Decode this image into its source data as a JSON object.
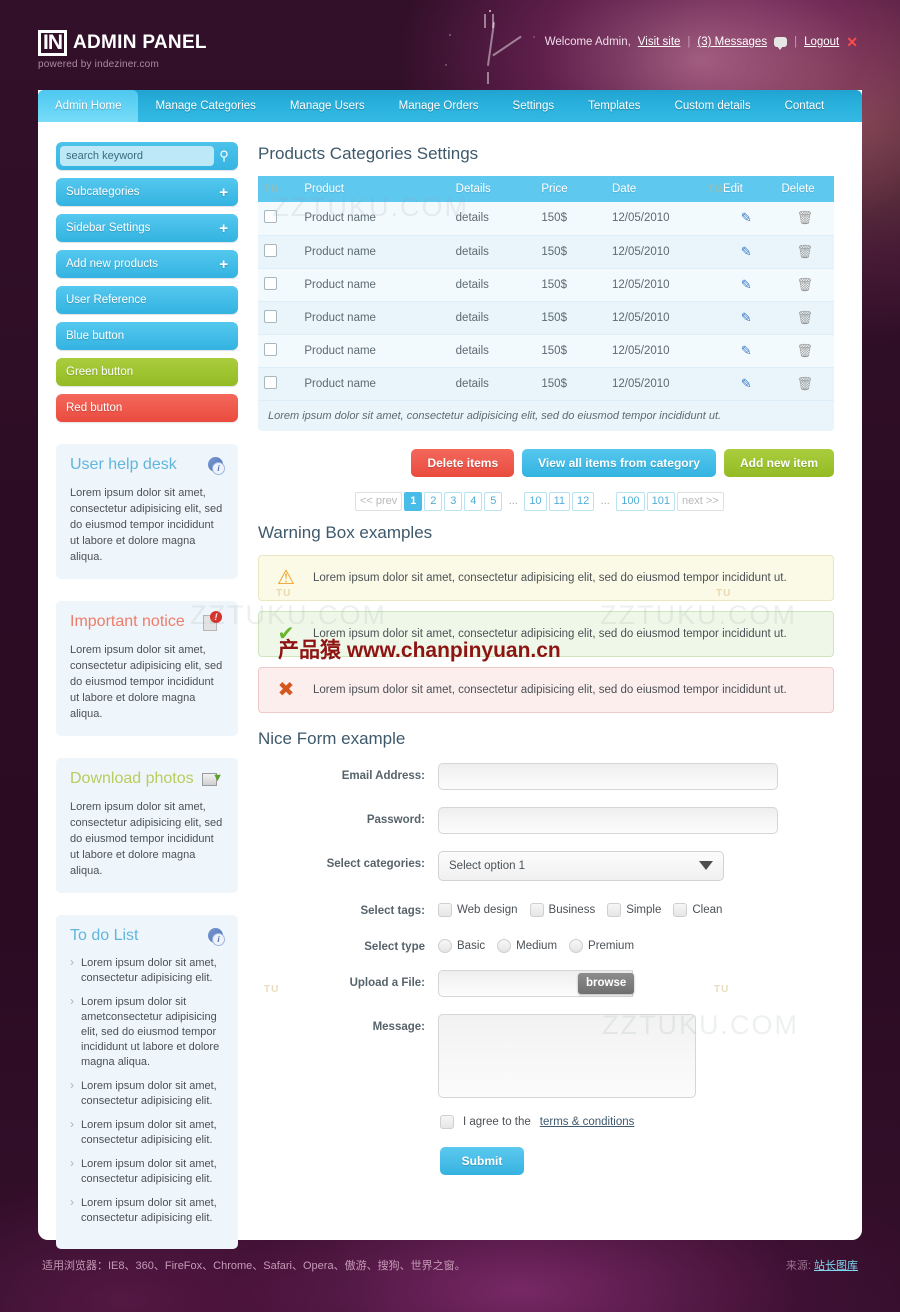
{
  "header": {
    "logo_mark": "IN",
    "logo_text": "ADMIN PANEL",
    "logo_sub": "powered by indeziner.com",
    "welcome": "Welcome Admin,",
    "visit_site": "Visit site",
    "messages": "(3) Messages",
    "logout": "Logout",
    "sep": "|"
  },
  "nav": {
    "items": [
      {
        "label": "Admin Home",
        "active": true
      },
      {
        "label": "Manage Categories",
        "active": false
      },
      {
        "label": "Manage Users",
        "active": false
      },
      {
        "label": "Manage Orders",
        "active": false
      },
      {
        "label": "Settings",
        "active": false
      },
      {
        "label": "Templates",
        "active": false
      },
      {
        "label": "Custom details",
        "active": false
      },
      {
        "label": "Contact",
        "active": false
      }
    ]
  },
  "sidebar": {
    "search": {
      "value": "search keyword",
      "placeholder": "search keyword"
    },
    "buttons": [
      {
        "label": "Subcategories",
        "plus": "+",
        "color": "blue"
      },
      {
        "label": "Sidebar Settings",
        "plus": "+",
        "color": "blue"
      },
      {
        "label": "Add new products",
        "plus": "+",
        "color": "blue"
      },
      {
        "label": "User Reference",
        "plus": "",
        "color": "blue"
      },
      {
        "label": "Blue button",
        "plus": "",
        "color": "blue"
      },
      {
        "label": "Green button",
        "plus": "",
        "color": "green"
      },
      {
        "label": "Red button",
        "plus": "",
        "color": "red"
      }
    ],
    "widgets": [
      {
        "title": "User help desk",
        "icon": "user-info-icon",
        "body": "Lorem ipsum dolor sit amet, consectetur adipisicing elit, sed do eiusmod tempor incididunt ut labore et dolore magna aliqua."
      },
      {
        "title": "Important notice",
        "icon": "document-alert-icon",
        "body": "Lorem ipsum dolor sit amet, consectetur adipisicing elit, sed do eiusmod tempor incididunt ut labore et dolore magna aliqua."
      },
      {
        "title": "Download photos",
        "icon": "download-image-icon",
        "body": "Lorem ipsum dolor sit amet, consectetur adipisicing elit, sed do eiusmod tempor incididunt ut labore et dolore magna aliqua."
      }
    ],
    "todo": {
      "title": "To do List",
      "icon": "user-info-icon",
      "items": [
        "Lorem ipsum dolor sit amet, consectetur adipisicing elit.",
        "Lorem ipsum dolor sit ametconsectetur adipisicing elit, sed do eiusmod tempor incididunt ut labore et dolore magna aliqua.",
        "Lorem ipsum dolor sit amet, consectetur adipisicing elit.",
        "Lorem ipsum dolor sit amet, consectetur adipisicing elit.",
        "Lorem ipsum dolor sit amet, consectetur adipisicing elit.",
        "Lorem ipsum dolor sit amet, consectetur adipisicing elit."
      ]
    }
  },
  "main": {
    "table_title": "Products Categories Settings",
    "table": {
      "headers": [
        "",
        "Product",
        "Details",
        "Price",
        "Date",
        "Edit",
        "Delete"
      ],
      "rows": [
        {
          "product": "Product name",
          "details": "details",
          "price": "150$",
          "date": "12/05/2010"
        },
        {
          "product": "Product name",
          "details": "details",
          "price": "150$",
          "date": "12/05/2010"
        },
        {
          "product": "Product name",
          "details": "details",
          "price": "150$",
          "date": "12/05/2010"
        },
        {
          "product": "Product name",
          "details": "details",
          "price": "150$",
          "date": "12/05/2010"
        },
        {
          "product": "Product name",
          "details": "details",
          "price": "150$",
          "date": "12/05/2010"
        },
        {
          "product": "Product name",
          "details": "details",
          "price": "150$",
          "date": "12/05/2010"
        }
      ],
      "footer_note": "Lorem ipsum dolor sit amet, consectetur adipisicing elit, sed do eiusmod tempor incididunt ut."
    },
    "actions": {
      "delete": "Delete items",
      "view_all": "View all items from category",
      "add_new": "Add new item"
    },
    "pagination": {
      "prev": "<< prev",
      "next": "next >>",
      "pages": [
        "1",
        "2",
        "3",
        "4",
        "5",
        "...",
        "10",
        "11",
        "12",
        "...",
        "100",
        "101"
      ],
      "current": "1"
    },
    "warning_title": "Warning Box examples",
    "warnings": [
      {
        "type": "warn",
        "icon": "warning-triangle-icon",
        "glyph": "⚠",
        "text": "Lorem ipsum dolor sit amet, consectetur adipisicing elit, sed do eiusmod tempor incididunt ut."
      },
      {
        "type": "ok",
        "icon": "check-mark-icon",
        "glyph": "✔",
        "text": "Lorem ipsum dolor sit amet, consectetur adipisicing elit, sed do eiusmod tempor incididunt ut."
      },
      {
        "type": "err",
        "icon": "error-cross-icon",
        "glyph": "✖",
        "text": "Lorem ipsum dolor sit amet, consectetur adipisicing elit, sed do eiusmod tempor incididunt ut."
      }
    ],
    "form_title": "Nice Form example",
    "form": {
      "email_label": "Email Address:",
      "email_value": "",
      "password_label": "Password:",
      "password_value": "",
      "categories_label": "Select categories:",
      "categories_value": "Select option 1",
      "tags_label": "Select tags:",
      "tags": [
        "Web design",
        "Business",
        "Simple",
        "Clean"
      ],
      "type_label": "Select type",
      "types": [
        "Basic",
        "Medium",
        "Premium"
      ],
      "upload_label": "Upload a File:",
      "upload_value": "",
      "browse": "browse",
      "message_label": "Message:",
      "message_value": "",
      "agree_prefix": "I agree to the",
      "agree_link": "terms & conditions",
      "submit": "Submit"
    }
  },
  "footer": {
    "browsers": "适用浏览器：IE8、360、FireFox、Chrome、Safari、Opera、傲游、搜狗、世界之窗。",
    "source_label": "来源:",
    "source_link": "站长图库"
  },
  "watermark": {
    "zz": "ZZTUKU.COM",
    "tu": "TU",
    "cpy": "产品猿  www.chanpinyuan.cn"
  },
  "colors": {
    "accent_blue": "#49bde8",
    "green": "#a0c62f",
    "red": "#ea4b3e",
    "header_bg": "#2a0d22"
  }
}
